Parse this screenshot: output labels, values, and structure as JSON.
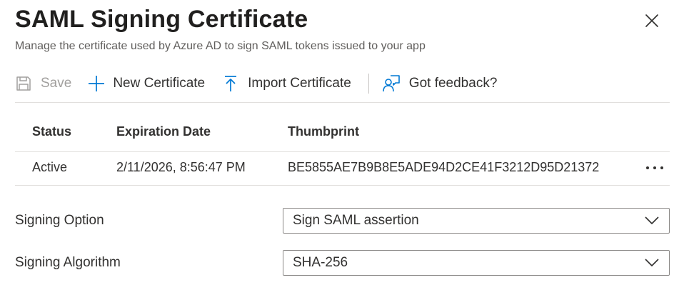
{
  "panel": {
    "title": "SAML Signing Certificate",
    "subtitle": "Manage the certificate used by Azure AD to sign SAML tokens issued to your app"
  },
  "toolbar": {
    "save_label": "Save",
    "new_cert_label": "New Certificate",
    "import_cert_label": "Import Certificate",
    "feedback_label": "Got feedback?"
  },
  "cert_table": {
    "headers": {
      "status": "Status",
      "expiration": "Expiration Date",
      "thumbprint": "Thumbprint"
    },
    "rows": [
      {
        "status": "Active",
        "expiration": "2/11/2026, 8:56:47 PM",
        "thumbprint": "BE5855AE7B9B8E5ADE94D2CE41F3212D95D21372"
      }
    ]
  },
  "settings": {
    "signing_option": {
      "label": "Signing Option",
      "value": "Sign SAML assertion"
    },
    "signing_algorithm": {
      "label": "Signing Algorithm",
      "value": "SHA-256"
    }
  },
  "colors": {
    "accent": "#0078d4",
    "text": "#323130",
    "muted": "#605e5c",
    "disabled": "#a19f9d",
    "border": "#8a8886",
    "divider": "#e1dfdd"
  },
  "icons": {
    "close": "close-icon",
    "save": "save-icon",
    "new": "plus-icon",
    "import": "upload-icon",
    "feedback": "feedback-icon",
    "more": "more-icon",
    "dropdown": "chevron-down-icon"
  }
}
